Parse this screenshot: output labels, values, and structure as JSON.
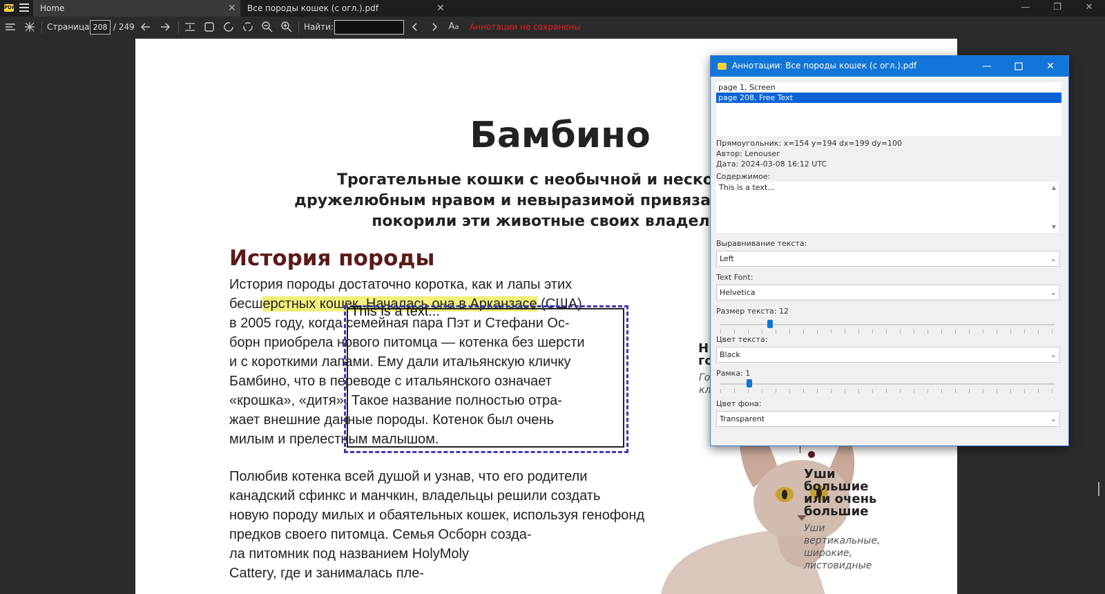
{
  "tabs": {
    "home_label": "Home",
    "doc_label": "Все породы кошек (с огл.).pdf",
    "close_glyph": "✕"
  },
  "window_controls": {
    "minimize": "—",
    "restore": "❐",
    "close": "✕"
  },
  "toolbar": {
    "page_label": "Страница:",
    "page_current": "208",
    "page_total": "/ 249",
    "find_label": "Найти:",
    "find_value": "",
    "status_unsaved": "Аннотации не сохранены",
    "icons": [
      "toc-icon",
      "layout-icon",
      "prev-arrow-icon",
      "next-arrow-icon",
      "fit-width-icon",
      "fit-page-icon",
      "rotate-left-icon",
      "rotate-right-icon",
      "zoom-out-icon",
      "zoom-in-icon",
      "find-prev-icon",
      "find-next-icon",
      "match-case-icon"
    ]
  },
  "document": {
    "title": "Бамбино",
    "subtitle_lines": [
      "Трогательные кошки с необычной и несколько детск",
      "дружелюбным нравом и невыразимой привязанностью к че",
      "покорили эти животные своих владельцев и ге"
    ],
    "section_heading": "История породы",
    "para1": [
      "История породы достаточно коротка, как и лапы этих",
      "бесш",
      "ерстных кошек. Началась она в Арканзасе",
      " (США)",
      "в 2005 году, когда семейная пара Пэт и Стефани Ос-",
      "борн приобрела нового питомца — котенка без шерсти",
      "и с короткими лапами. Ему дали итальянскую кличку",
      "Бамбино, что в переводе с итальянского означает",
      "«крошка», «дитя». Такое название полностью отра-",
      "жает внешние данные породы. Котенок был очень",
      "милым и прелестным малышом."
    ],
    "para2": [
      "Полюбив котенка всей душой и узнав, что его родители",
      "канадский сфинкс и манчкин, владельцы решили создать",
      "новую породу милых и обаятельных кошек, используя генофонд",
      "предков своего питомца. Семья Осборн созда-",
      "ла питомник под названием HolyMoly",
      "Cattery, где и занималась пле-"
    ],
    "annotation_text": "This is a text...",
    "side_top": [
      "Н",
      "го"
    ],
    "side_top_italic": [
      "Го",
      "кл"
    ],
    "side_ears_title": [
      "Уши",
      "большие",
      "или очень",
      "большие"
    ],
    "side_ears_desc": [
      "Уши",
      "вертикальные,",
      "широкие,",
      "листовидные"
    ]
  },
  "dialog": {
    "title": "Аннотации: Все породы кошек (с огл.).pdf",
    "list": [
      {
        "label": "page 1, Screen",
        "selected": false
      },
      {
        "label": "page 208, Free Text",
        "selected": true
      }
    ],
    "rect_info": "Прямоугольник: x=154 y=194 dx=199 dy=100",
    "author": "Автор: Lenouser",
    "date": "Дата: 2024-03-08 16:12 UTC",
    "content_label": "Содержимое:",
    "content_value": "This is a text...",
    "align_label": "Выравнивание текста:",
    "align_value": "Left",
    "font_label": "Text Font:",
    "font_value": "Helvetica",
    "size_label": "Размер текста: 12",
    "size_value": 12,
    "color_label": "Цвет текста:",
    "color_value": "Black",
    "border_label": "Рамка: 1",
    "border_value": 1,
    "bg_label": "Цвет фона:",
    "bg_value": "Transparent",
    "chevron": "⌄"
  },
  "colors": {
    "accent": "#1175d9",
    "status_red": "#e02020",
    "highlight": "#f2f07a",
    "heading": "#5b1a1a",
    "annotation_border": "#3a3ab8"
  }
}
